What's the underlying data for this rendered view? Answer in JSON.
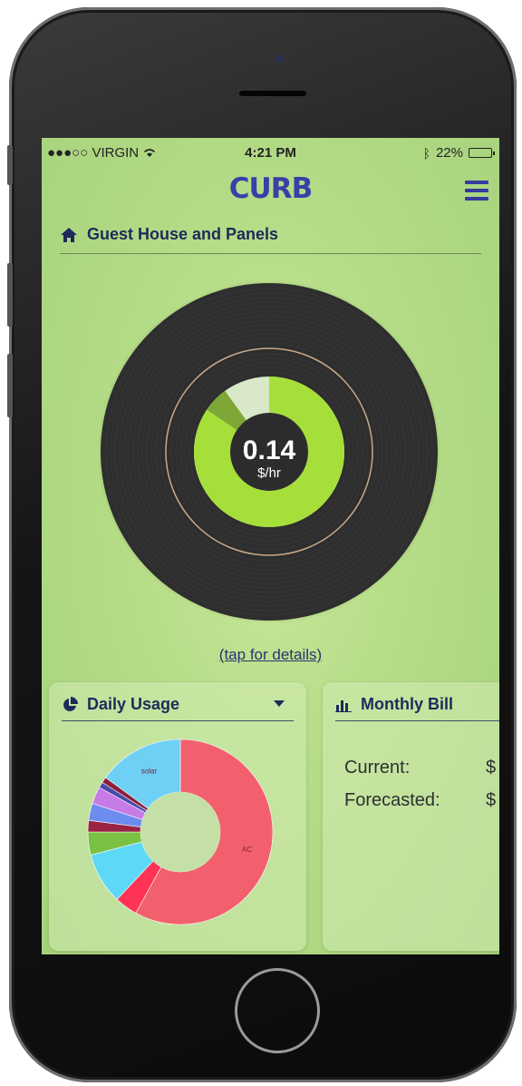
{
  "status_bar": {
    "carrier": "●●●○○ VIRGIN",
    "time": "4:21 PM",
    "battery": "22%",
    "battery_level": 0.22
  },
  "app": {
    "logo": "CURB"
  },
  "location": {
    "name": "Guest House and Panels"
  },
  "gauge": {
    "value": "0.14",
    "unit": "$/hr",
    "fill_fraction": 0.9,
    "tap_hint": "(tap for details)"
  },
  "daily_usage": {
    "title": "Daily Usage",
    "chart_data": {
      "type": "pie",
      "labels": [
        "AC",
        "solar"
      ],
      "slices": [
        {
          "label": "AC",
          "value": 58,
          "color": "#f2606e"
        },
        {
          "label": "",
          "value": 4,
          "color": "#ff3355"
        },
        {
          "label": "",
          "value": 9,
          "color": "#5ed8f7"
        },
        {
          "label": "",
          "value": 4,
          "color": "#7ac142"
        },
        {
          "label": "",
          "value": 2,
          "color": "#9b2343"
        },
        {
          "label": "",
          "value": 3,
          "color": "#6d8cf0"
        },
        {
          "label": "",
          "value": 3,
          "color": "#c77be6"
        },
        {
          "label": "",
          "value": 1,
          "color": "#4a4aa8"
        },
        {
          "label": "",
          "value": 1,
          "color": "#8a1e3c"
        },
        {
          "label": "solar",
          "value": 15,
          "color": "#6ed0f5"
        }
      ]
    }
  },
  "monthly_bill": {
    "title": "Monthly Bill",
    "rows": [
      {
        "label": "Current:",
        "value": "$"
      },
      {
        "label": "Forecasted:",
        "value": "$"
      }
    ]
  },
  "colors": {
    "accent": "#3b3fa8",
    "gauge_green": "#a6df3a",
    "screen_bg": "#b5dc87"
  }
}
